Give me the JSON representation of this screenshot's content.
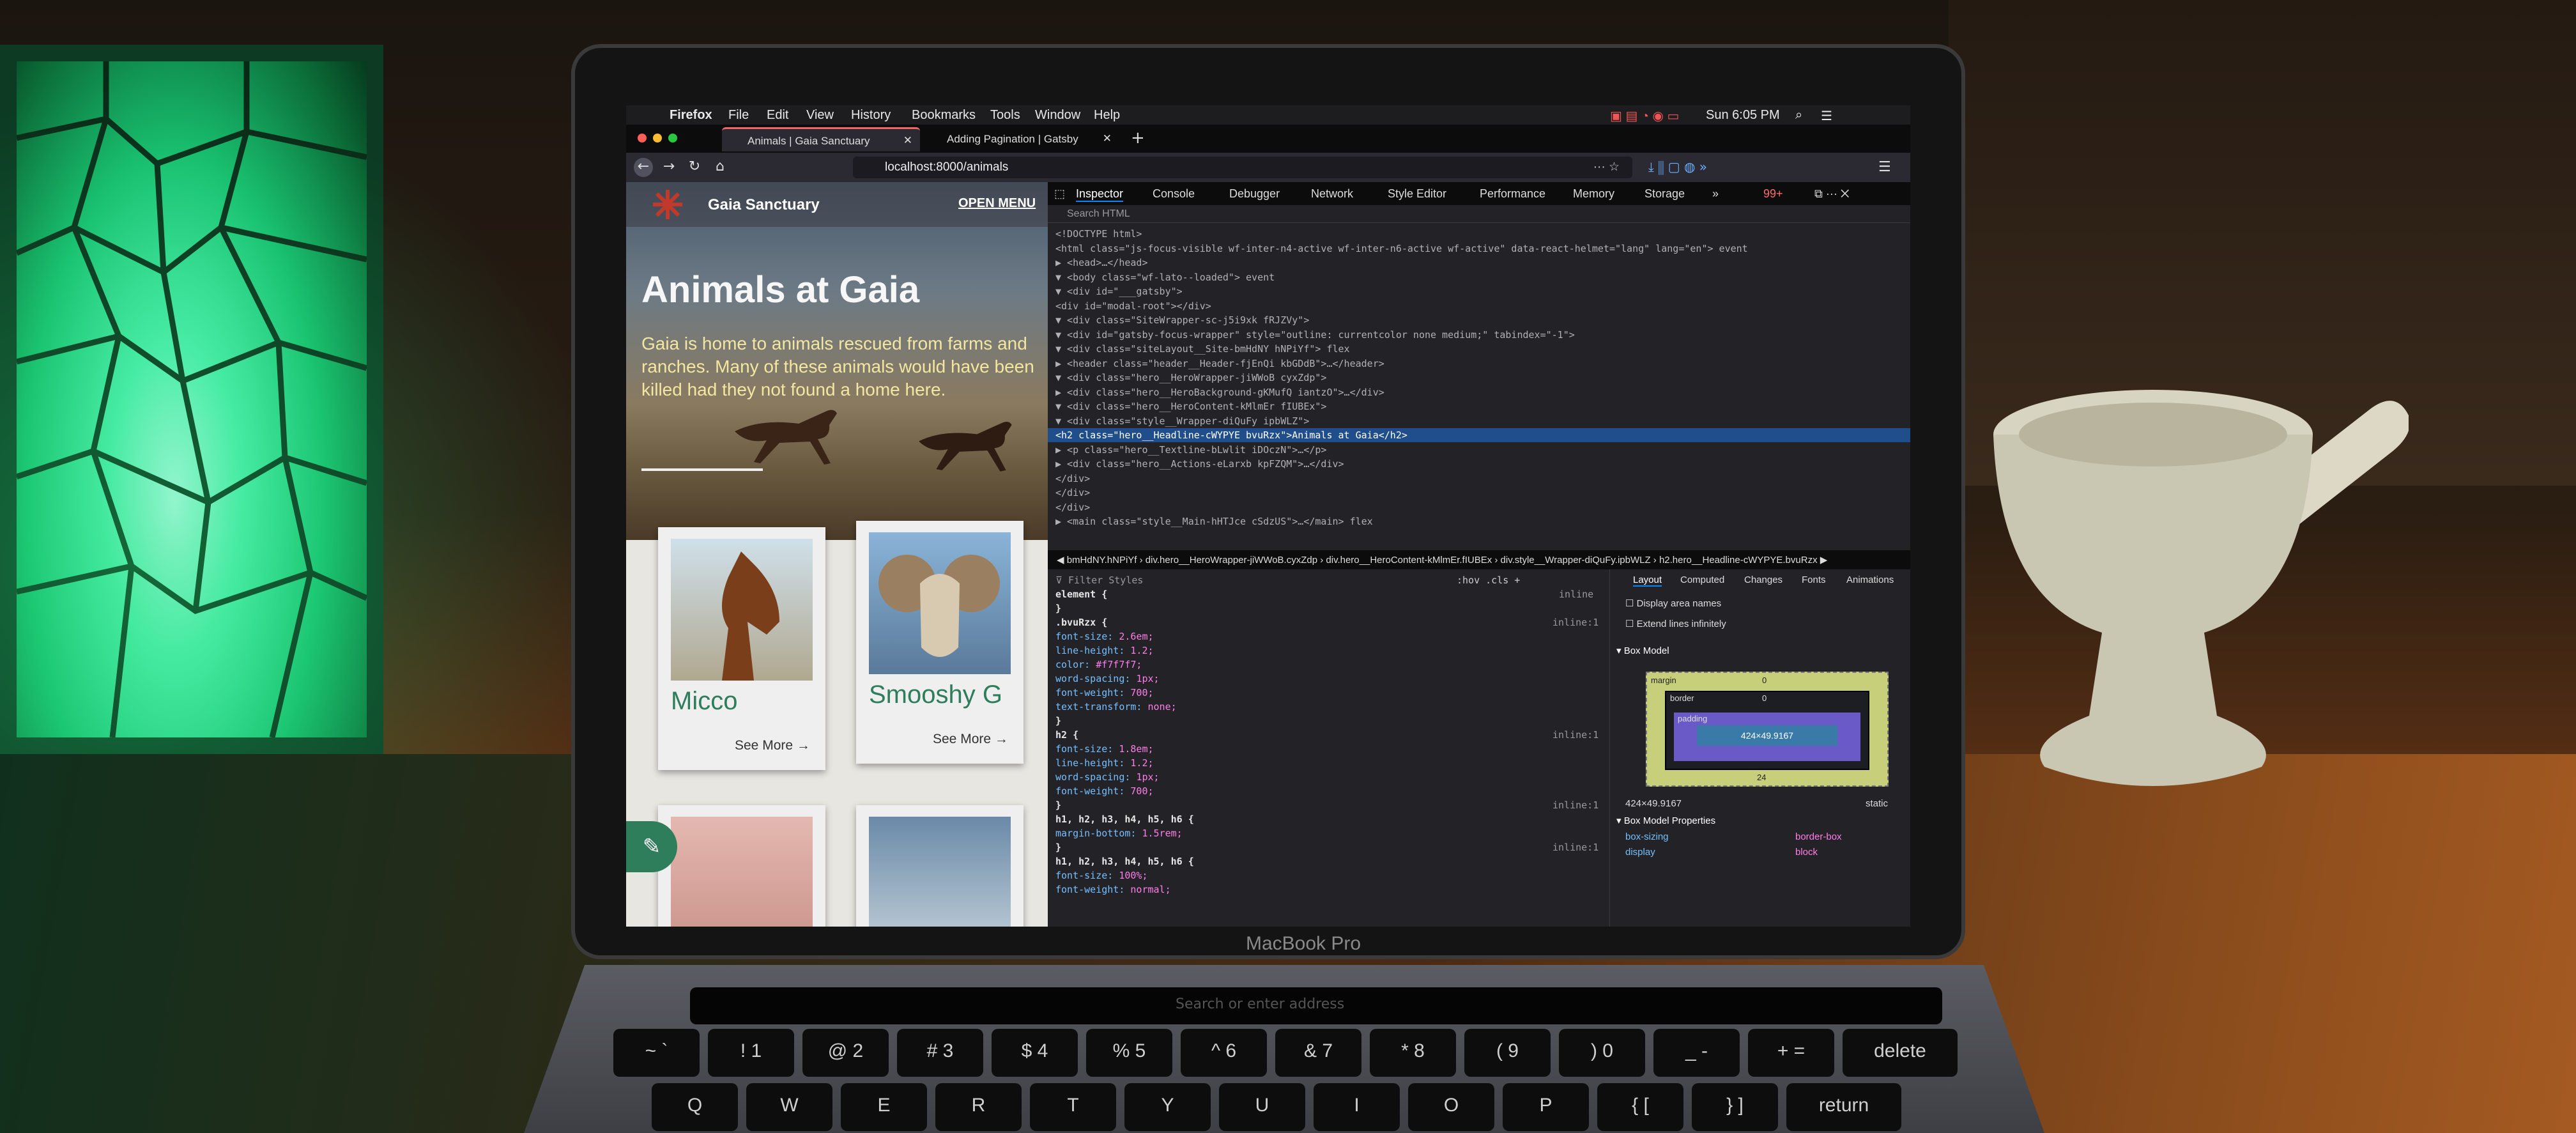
{
  "macos_menubar": {
    "app": "Firefox",
    "items": [
      "File",
      "Edit",
      "View",
      "History",
      "Bookmarks",
      "Tools",
      "Window",
      "Help"
    ],
    "clock": "Sun 6:05 PM"
  },
  "browser": {
    "tabs": [
      {
        "label": "Animals | Gaia Sanctuary",
        "active": true
      },
      {
        "label": "Adding Pagination | Gatsby",
        "active": false
      }
    ],
    "url": "localhost:8000/animals"
  },
  "site": {
    "brand": "Gaia Sanctuary",
    "menu_label": "OPEN MENU",
    "hero_title": "Animals at Gaia",
    "hero_tagline": "Gaia is home to animals rescued from farms and ranches. Many of these animals would have been killed had they not found a home here.",
    "cards": [
      {
        "name": "Micco",
        "more": "See More →"
      },
      {
        "name": "Smooshy G",
        "more": "See More →"
      },
      {
        "name": "",
        "more": ""
      },
      {
        "name": "",
        "more": ""
      }
    ]
  },
  "devtools": {
    "tabs": [
      "Inspector",
      "Console",
      "Debugger",
      "Network",
      "Style Editor",
      "Performance",
      "Memory",
      "Storage"
    ],
    "error_count": "99+",
    "search_placeholder": "Search HTML",
    "dom_lines": [
      "<!DOCTYPE html>",
      "<html class=\"js-focus-visible wf-inter-n4-active wf-inter-n6-active wf-active\" data-react-helmet=\"lang\" lang=\"en\"> event",
      "▶ <head>…</head>",
      "▼ <body class=\"wf-lato--loaded\"> event",
      "  ▼ <div id=\"___gatsby\">",
      "      <div id=\"modal-root\"></div>",
      "    ▼ <div class=\"SiteWrapper-sc-j5i9xk fRJZVy\">",
      "      ▼ <div id=\"gatsby-focus-wrapper\" style=\"outline: currentcolor none medium;\" tabindex=\"-1\">",
      "        ▼ <div class=\"siteLayout__Site-bmHdNY hNPiYf\"> flex",
      "          ▶ <header class=\"header__Header-fjEnQi kbGDdB\">…</header>",
      "          ▼ <div class=\"hero__HeroWrapper-jiWWoB cyxZdp\">",
      "            ▶ <div class=\"hero__HeroBackground-gKMufQ iantzO\">…</div>",
      "            ▼ <div class=\"hero__HeroContent-kMlmEr fIUBEx\">",
      "              ▼ <div class=\"style__Wrapper-diQuFy ipbWLZ\">",
      "                  <h2 class=\"hero__Headline-cWYPYE bvuRzx\">Animals at Gaia</h2>",
      "                ▶ <p class=\"hero__Textline-bLwlit iDOczN\">…</p>",
      "                ▶ <div class=\"hero__Actions-eLarxb kpFZQM\">…</div>",
      "                </div>",
      "              </div>",
      "            </div>",
      "          ▶ <main class=\"style__Main-hHTJce cSdzUS\">…</main> flex"
    ],
    "breadcrumbs": "◀ bmHdNY.hNPiYf  ›  div.hero__HeroWrapper-jiWWoB.cyxZdp  ›  div.hero__HeroContent-kMlmEr.fIUBEx  ›  div.style__Wrapper-diQuFy.ipbWLZ  ›  h2.hero__Headline-cWYPYE.bvuRzx ▶",
    "rules": {
      "filter_label": "Filter Styles",
      "toolbar": ":hov  .cls  +",
      "lines": [
        "element {",
        "}",
        ".bvuRzx {",
        "  font-size: 2.6em;",
        "  line-height: 1.2;",
        "  color: #f7f7f7;",
        "  word-spacing: 1px;",
        "  font-weight: 700;",
        "  text-transform: none;",
        "}",
        "h2 {",
        "  font-size: 1.8em;",
        "  line-height: 1.2;",
        "  word-spacing: 1px;",
        "  font-weight: 700;",
        "}",
        "h1, h2, h3, h4, h5, h6 {",
        "  margin-bottom: 1.5rem;",
        "}",
        "h1, h2, h3, h4, h5, h6 {",
        "  font-size: 100%;",
        "  font-weight: normal;"
      ],
      "sources": [
        "inline",
        "inline:1",
        "inline:1",
        "inline:1",
        "inline:1"
      ]
    },
    "layout": {
      "tabs": [
        "Layout",
        "Computed",
        "Changes",
        "Fonts",
        "Animations"
      ],
      "options": [
        "Display area names",
        "Extend lines infinitely"
      ],
      "box_model_title": "Box Model",
      "margin_label": "margin",
      "border_label": "border",
      "padding_label": "padding",
      "content_size": "424×49.9167",
      "zero": "0",
      "margin_bottom": "24",
      "size_readout": "424×49.9167",
      "position": "static",
      "props_title": "Box Model Properties",
      "props": [
        {
          "name": "box-sizing",
          "value": "border-box"
        },
        {
          "name": "display",
          "value": "block"
        }
      ]
    }
  },
  "laptop": {
    "brand": "MacBook Pro",
    "touchbar_search": "Search or enter address",
    "keys_row1": [
      "~ `",
      "! 1",
      "@ 2",
      "# 3",
      "$ 4",
      "% 5",
      "^ 6",
      "& 7",
      "* 8",
      "( 9",
      ") 0",
      "_ -",
      "+ =",
      "delete"
    ],
    "keys_row2": [
      "Q",
      "W",
      "E",
      "R",
      "T",
      "Y",
      "U",
      "I",
      "O",
      "P",
      "{ [",
      "} ]",
      "return"
    ]
  }
}
